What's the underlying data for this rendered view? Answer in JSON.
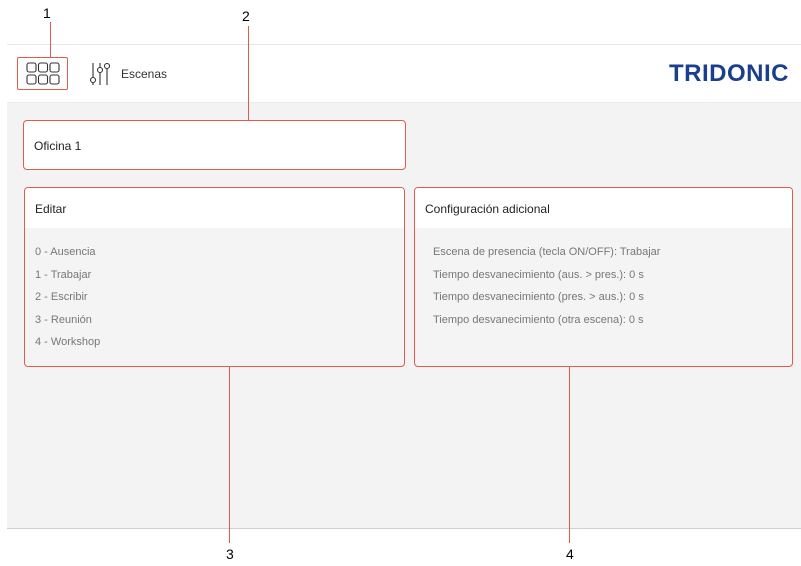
{
  "callouts": [
    "1",
    "2",
    "3",
    "4"
  ],
  "header": {
    "home_icon": "grid-icon",
    "scenes_icon": "sliders-icon",
    "scenes_label": "Escenas",
    "logo": "TRIDONIC"
  },
  "room": {
    "title": "Oficina 1"
  },
  "edit_card": {
    "title": "Editar",
    "scenes": [
      "0 - Ausencia",
      "1 - Trabajar",
      "2 - Escribir",
      "3 - Reunión",
      "4 - Workshop"
    ]
  },
  "config_card": {
    "title": "Configuración adicional",
    "items": [
      "Escena de presencia (tecla ON/OFF): Trabajar",
      "Tiempo desvanecimiento (aus. > pres.): 0 s",
      "Tiempo desvanecimiento (pres. > aus.): 0 s",
      "Tiempo desvanecimiento (otra escena): 0 s"
    ]
  },
  "colors": {
    "accent_outline": "#e05a4e",
    "logo": "#1b3f8f",
    "background": "#f3f3f3"
  }
}
